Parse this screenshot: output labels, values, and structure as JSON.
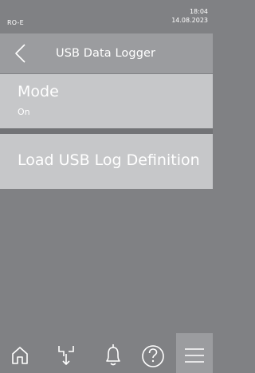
{
  "status": {
    "device": "RO-E",
    "time": "18:04",
    "date": "14.08.2023"
  },
  "header": {
    "title": "USB Data Logger"
  },
  "items": [
    {
      "title": "Mode",
      "value": "On"
    },
    {
      "title": "Load USB Log Definition"
    }
  ],
  "nav": [
    "home-icon",
    "drain-icon",
    "bell-icon",
    "help-icon",
    "menu-icon"
  ],
  "colors": {
    "background": "#808184",
    "header": "#9b9c9f",
    "item": "#c6c7c9",
    "text": "#ffffff"
  }
}
